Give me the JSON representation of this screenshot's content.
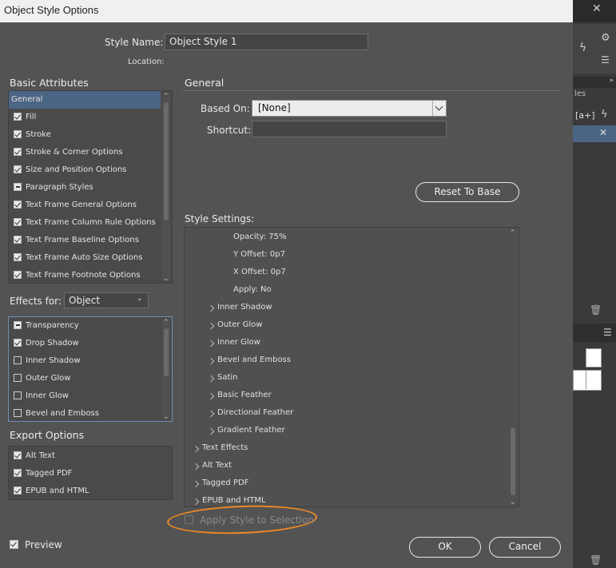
{
  "window": {
    "title": "Object Style Options"
  },
  "style_name": {
    "label": "Style Name:",
    "value": "Object Style 1"
  },
  "location": {
    "label": "Location:"
  },
  "basic_attributes": {
    "header": "Basic Attributes",
    "items": [
      {
        "label": "General",
        "state": "none",
        "selected": true
      },
      {
        "label": "Fill",
        "state": "checked"
      },
      {
        "label": "Stroke",
        "state": "checked"
      },
      {
        "label": "Stroke & Corner Options",
        "state": "checked"
      },
      {
        "label": "Size and Position Options",
        "state": "checked"
      },
      {
        "label": "Paragraph Styles",
        "state": "partial"
      },
      {
        "label": "Text Frame General Options",
        "state": "checked"
      },
      {
        "label": "Text Frame Column Rule Options",
        "state": "checked"
      },
      {
        "label": "Text Frame Baseline Options",
        "state": "checked"
      },
      {
        "label": "Text Frame Auto Size Options",
        "state": "checked"
      },
      {
        "label": "Text Frame Footnote Options",
        "state": "checked"
      }
    ]
  },
  "effects_for": {
    "label": "Effects for:",
    "value": "Object",
    "items": [
      {
        "label": "Transparency",
        "state": "partial"
      },
      {
        "label": "Drop Shadow",
        "state": "checked"
      },
      {
        "label": "Inner Shadow",
        "state": "unchecked"
      },
      {
        "label": "Outer Glow",
        "state": "unchecked"
      },
      {
        "label": "Inner Glow",
        "state": "unchecked"
      },
      {
        "label": "Bevel and Emboss",
        "state": "unchecked"
      }
    ]
  },
  "export_options": {
    "header": "Export Options",
    "items": [
      {
        "label": "Alt Text",
        "state": "checked"
      },
      {
        "label": "Tagged PDF",
        "state": "checked"
      },
      {
        "label": "EPUB and HTML",
        "state": "checked"
      }
    ]
  },
  "general": {
    "header": "General",
    "based_on_label": "Based On:",
    "based_on_value": "[None]",
    "shortcut_label": "Shortcut:",
    "shortcut_value": "",
    "reset_button": "Reset To Base"
  },
  "style_settings": {
    "header": "Style Settings:",
    "rows": [
      {
        "label": "Opacity: 75%",
        "level": 2,
        "arrow": false
      },
      {
        "label": "Y Offset: 0p7",
        "level": 2,
        "arrow": false
      },
      {
        "label": "X Offset: 0p7",
        "level": 2,
        "arrow": false
      },
      {
        "label": "Apply: No",
        "level": 2,
        "arrow": false
      },
      {
        "label": "Inner Shadow",
        "level": 1,
        "arrow": true
      },
      {
        "label": "Outer Glow",
        "level": 1,
        "arrow": true
      },
      {
        "label": "Inner Glow",
        "level": 1,
        "arrow": true
      },
      {
        "label": "Bevel and Emboss",
        "level": 1,
        "arrow": true
      },
      {
        "label": "Satin",
        "level": 1,
        "arrow": true
      },
      {
        "label": "Basic Feather",
        "level": 1,
        "arrow": true
      },
      {
        "label": "Directional Feather",
        "level": 1,
        "arrow": true
      },
      {
        "label": "Gradient Feather",
        "level": 1,
        "arrow": true
      },
      {
        "label": "Text Effects",
        "level": 0,
        "arrow": true
      },
      {
        "label": "Alt Text",
        "level": 0,
        "arrow": true
      },
      {
        "label": "Tagged PDF",
        "level": 0,
        "arrow": true
      },
      {
        "label": "EPUB and HTML",
        "level": 0,
        "arrow": true
      }
    ]
  },
  "apply_to_selection": {
    "label": "Apply Style to Selection",
    "enabled": false
  },
  "preview": {
    "label": "Preview",
    "checked": true
  },
  "buttons": {
    "ok": "OK",
    "cancel": "Cancel"
  },
  "side_panel": {
    "close_glyph": "✕",
    "tab_fragment": "les",
    "button_text": "[a+]"
  },
  "colors": {
    "dialog_bg": "#535353",
    "annotation_orange": "#f08a24",
    "selected_row": "#4b6584"
  }
}
